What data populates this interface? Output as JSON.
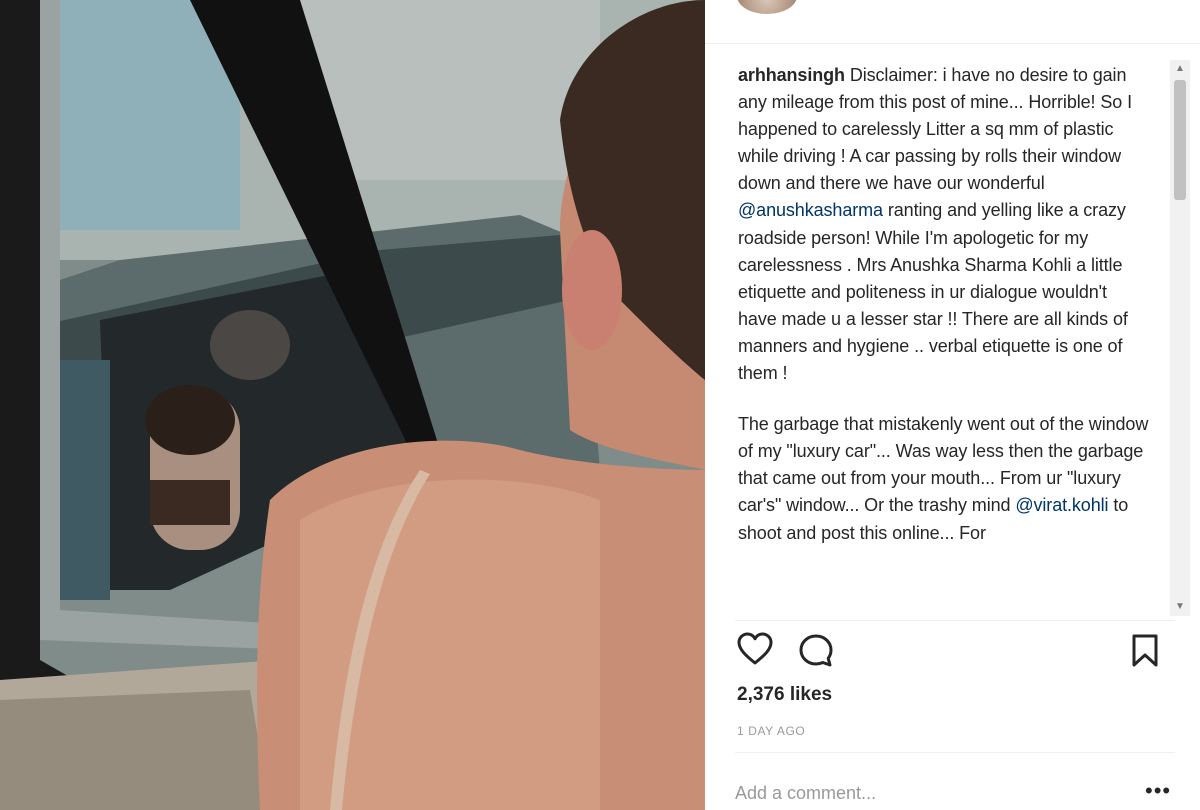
{
  "post": {
    "caption": {
      "username": "arhhansingh",
      "paragraph1_before": "Disclaimer: i have no desire to gain any mileage from this post of mine... Horrible! So I happened to carelessly Litter a sq mm of plastic while driving ! A car passing by rolls their window down and there we have our wonderful ",
      "mention1": "@anushkasharma",
      "paragraph1_after": " ranting and yelling like a crazy roadside person! While I'm apologetic for my carelessness . Mrs Anushka Sharma Kohli a little etiquette and politeness in ur dialogue wouldn't have made u a lesser star !! There are all kinds of manners and hygiene .. verbal etiquette is one of them !",
      "paragraph2_before": "The garbage that mistakenly went out of the window of my \"luxury car\"... Was way less then the garbage that came out from your mouth... From ur \"luxury car's\" window... Or the trashy mind ",
      "mention2": "@virat.kohli",
      "paragraph2_after": " to shoot and post this online... For"
    },
    "likes": "2,376 likes",
    "timestamp": "1 DAY AGO",
    "comment_placeholder": "Add a comment...",
    "more_options": "•••"
  },
  "icons": {
    "like": "heart-icon",
    "comment": "comment-bubble-icon",
    "save": "bookmark-icon",
    "scroll_up": "▲",
    "scroll_down": "▼"
  },
  "colors": {
    "text": "#262626",
    "muted": "#999999",
    "mention": "#003569",
    "divider": "#efefef"
  }
}
